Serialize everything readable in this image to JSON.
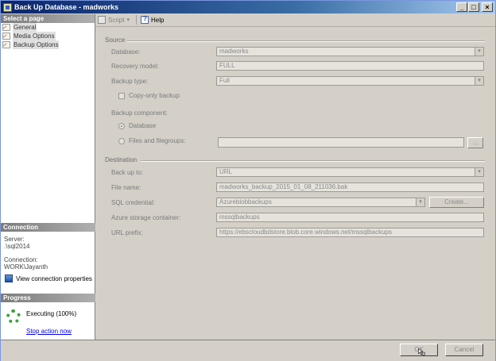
{
  "window": {
    "title": "Back Up Database - madworks"
  },
  "left_pane": {
    "select_page_header": "Select a page",
    "pages": [
      {
        "label": "General"
      },
      {
        "label": "Media Options"
      },
      {
        "label": "Backup Options"
      }
    ],
    "connection_header": "Connection",
    "server_label": "Server:",
    "server_value": ".\\sql2014",
    "connection_label": "Connection:",
    "connection_value": "WORK\\Jayanth",
    "view_connection_link": "View connection properties",
    "progress_header": "Progress",
    "progress_status": "Executing (100%)",
    "stop_action_link": "Stop action now"
  },
  "toolbar": {
    "script_label": "Script",
    "help_label": "Help"
  },
  "source": {
    "header": "Source",
    "database_label": "Database:",
    "database_value": "madworks",
    "recovery_model_label": "Recovery model:",
    "recovery_model_value": "FULL",
    "backup_type_label": "Backup type:",
    "backup_type_value": "Full",
    "copy_only_label": "Copy-only backup",
    "backup_component_label": "Backup component:",
    "database_option_label": "Database",
    "files_option_label": "Files and filegroups:",
    "browse_label": "..."
  },
  "destination": {
    "header": "Destination",
    "back_up_to_label": "Back up to:",
    "back_up_to_value": "URL",
    "file_name_label": "File name:",
    "file_name_value": "madworks_backup_2015_01_08_211036.bak",
    "sql_credential_label": "SQL credential:",
    "sql_credential_value": "Azureblobbackups",
    "create_label": "Create...",
    "azure_container_label": "Azure storage container:",
    "azure_container_value": "mssqlbackups",
    "url_prefix_label": "URL prefix:",
    "url_prefix_value": "https://ebscloudbdstore.blob.core.windows.net/mssqlbackups"
  },
  "buttons": {
    "ok_label": "OK",
    "cancel_label": "Cancel"
  },
  "colors": {
    "title_bar": "#0a246a",
    "link": "#0000ee",
    "progress_green": "#3aa23a"
  }
}
